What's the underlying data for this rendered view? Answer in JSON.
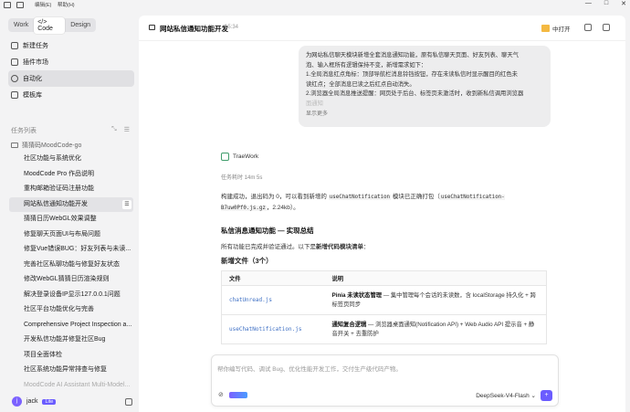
{
  "titlebar": {
    "menu": [
      "编辑(E)",
      "帮助(H)"
    ]
  },
  "sidebar": {
    "modes": [
      "Work",
      "</> Code",
      "Design"
    ],
    "nav": [
      "新建任务",
      "插件市场",
      "自动化",
      "模板库"
    ],
    "section_label": "任务列表",
    "folder": "猜猜码MoodCode-go",
    "tasks": [
      "社区功能与系统优化",
      "MoodCode Pro 作品说明",
      "重构邮箱验证码注册功能",
      "网站私信通知功能开发",
      "猜猜日历WebGL效果调整",
      "修复聊天页面UI与布局问题",
      "修复Vue错误BUG：好友列表与未读...",
      "完善社区私聊功能与修复好友状态",
      "修改WebGL猜猜日历渲染规则",
      "解决登录设备IP显示127.0.0.1问题",
      "社区平台功能优化与完善",
      "Comprehensive Project Inspection a...",
      "开发私信功能并修复社区Bug",
      "项目全面体检",
      "社区系统功能异常排查与修复",
      "MoodCode AI Assistant Multi-Model..."
    ],
    "user": {
      "name": "jack",
      "plan": "Lite"
    }
  },
  "header": {
    "title": "网站私信通知功能开发",
    "time": "15:34",
    "open_label": "中打开"
  },
  "user_message": {
    "lines": [
      "为网站私信聊天模块新增全套消息通知功能，原有私信聊天页面、好友列表、聊天气",
      "泡、输入框所有逻辑保持不变，新增需求如下：",
      "1.全局消息红点角标：顶部导航栏消息铃铛按钮，存在未读私信时显示醒目的红色未",
      "读红点；全部消息已读之后红点自动消失。",
      "2.浏览器全局消息推送提醒：网页处于后台、标签页未激活时，收到新私信调用浏览器",
      "面通知"
    ],
    "show_more": "显示更多"
  },
  "agent": {
    "name": "TraeWork",
    "task_time": "任务耗时 14m 5s",
    "build_pre": "构建成功，退出码为 0，可以看到新增的",
    "build_code1": "useChatNotification",
    "build_mid": "模块已正确打包（",
    "build_code2": "useChatNotification-B7uw0Pf0.js.gz",
    "build_post": "，2.24kb）。",
    "summary_title": "私信消息通知功能 — 实现总结",
    "summary_pre": "所有功能已完成并验证通过。以下是",
    "summary_bold": "新增代码模块清单",
    "summary_post": "：",
    "new_files": "新增文件（3个）",
    "table": {
      "headers": [
        "文件",
        "说明"
      ],
      "rows": [
        {
          "file": "chatUnread.js",
          "bold": "Pinia 未读状态管理",
          "desc": " — 集中管理每个会话的未读数，含 localStorage 持久化 + 跨标签页同步"
        },
        {
          "file": "useChatNotification.js",
          "bold": "通知复合逻辑",
          "desc": " — 浏览器桌面通知(Notification API) + Web Audio API 提示音 + 静音开关 + 去重防护"
        }
      ]
    }
  },
  "composer": {
    "placeholder": "帮你编写代码、调试 Bug、优化性能开发工作，交付生产级代码产物。",
    "model": "DeepSeek-V4-Flash ⌄"
  }
}
